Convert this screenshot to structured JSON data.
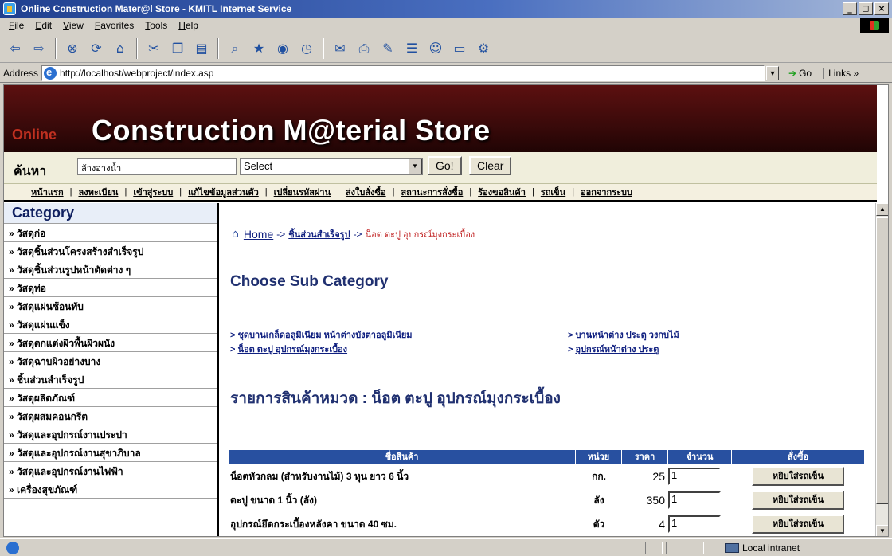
{
  "window": {
    "title": "Online Construction Mater@l Store - KMITL Internet Service"
  },
  "menu": [
    "File",
    "Edit",
    "View",
    "Favorites",
    "Tools",
    "Help"
  ],
  "address": {
    "label": "Address",
    "url": "http://localhost/webproject/index.asp",
    "go_label": "Go",
    "links_label": "Links »"
  },
  "banner": {
    "online": "Online",
    "title": "Construction M@terial Store"
  },
  "search": {
    "label": "ค้นหา",
    "value": "ล้างอ่างน้ำ",
    "select_value": "Select",
    "go_label": "Go!",
    "clear_label": "Clear"
  },
  "nav": [
    "หน้าแรก",
    "ลงทะเบียน",
    "เข้าสู่ระบบ",
    "แก้ไขข้อมูลส่วนตัว",
    "เปลี่ยนรหัสผ่าน",
    "ส่งใบสั่งซื้อ",
    "สถานะการสั่งซื้อ",
    "ร้องขอสินค้า",
    "รถเข็น",
    "ออกจากระบบ"
  ],
  "sidebar": {
    "title": "Category",
    "items": [
      "» วัสดุก่อ",
      "» วัสดุชิ้นส่วนโครงสร้างสำเร็จรูป",
      "» วัสดุชิ้นส่วนรูปหน้าตัดต่าง ๆ",
      "» วัสดุท่อ",
      "» วัสดุแผ่นซ้อนทับ",
      "» วัสดุแผ่นแข็ง",
      "» วัสดุตกแต่งผิวพื้นผิวผนัง",
      "» วัสดุฉาบผิวอย่างบาง",
      "» ชิ้นส่วนสำเร็จรูป",
      "» วัสดุผลิตภัณฑ์",
      "» วัสดุผสมคอนกรีต",
      "» วัสดุและอุปกรณ์งานประปา",
      "» วัสดุและอุปกรณ์งานสุขาภิบาล",
      "» วัสดุและอุปกรณ์งานไฟฟ้า",
      "» เครื่องสุขภัณฑ์"
    ]
  },
  "breadcrumb": {
    "home": "Home",
    "arrow": "->",
    "level2": "ชิ้นส่วนสำเร็จรูป",
    "current": "น็อต ตะปู อุปกรณ์มุงกระเบื้อง"
  },
  "subcategory": {
    "title": "Choose Sub Category",
    "links": [
      "ชุดบานเกล็ดอลูมิเนียม หน้าต่างบังตาอลูมิเนียม",
      "บานหน้าต่าง ประตู วงกบไม้",
      "น็อต ตะปู อุปกรณ์มุงกระเบื้อง",
      "อุปกรณ์หน้าต่าง ประตู"
    ]
  },
  "products": {
    "title": "รายการสินค้าหมวด : น็อต ตะปู อุปกรณ์มุงกระเบื้อง",
    "headers": [
      "ชื่อสินค้า",
      "หน่วย",
      "ราคา",
      "จำนวน",
      "สั่งซื้อ"
    ],
    "rows": [
      {
        "name": "น็อตหัวกลม (สำหรับงานไม้) 3 หุน ยาว 6 นิ้ว",
        "unit": "กก.",
        "price": "25",
        "qty": "1",
        "button": "หยิบใส่รถเข็น"
      },
      {
        "name": "ตะปู ขนาด 1 นิ้ว (ลัง)",
        "unit": "ลัง",
        "price": "350",
        "qty": "1",
        "button": "หยิบใส่รถเข็น"
      },
      {
        "name": "อุปกรณ์ยึดกระเบื้องหลังคา ขนาด 40 ซม.",
        "unit": "ตัว",
        "price": "4",
        "qty": "1",
        "button": "หยิบใส่รถเข็น"
      }
    ]
  },
  "status": {
    "zone": "Local intranet"
  }
}
